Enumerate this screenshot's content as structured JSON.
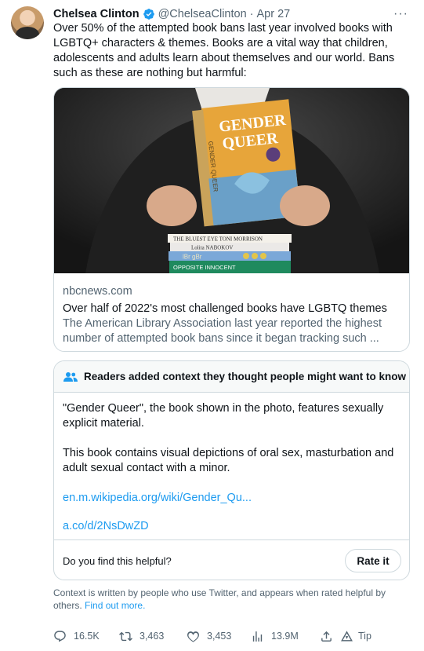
{
  "author": {
    "name": "Chelsea Clinton",
    "handle": "@ChelseaClinton",
    "separator": "·",
    "date": "Apr 27",
    "more_label": "···"
  },
  "tweet": {
    "text": "Over 50% of the attempted book bans last year involved books with LGBTQ+ characters & themes. Books are a vital way that children, adolescents and adults learn about themselves and our world. Bans such as these are nothing but harmful:"
  },
  "card": {
    "book_title_line1": "GENDER",
    "book_title_line2": "QUEER",
    "book_spine": "GENDER QUEER",
    "stack_books": [
      "THE BLUEST EYE   TONI MORRISON",
      "Lolita   NABOKOV",
      "lBr gBr",
      "OPPOSITE  INNOCENT"
    ],
    "domain": "nbcnews.com",
    "title": "Over half of 2022's most challenged books have LGBTQ themes",
    "description": "The American Library Association last year reported the highest number of attempted book bans since it began tracking such ..."
  },
  "note": {
    "heading": "Readers added context they thought people might want to know",
    "paragraph1": "\"Gender Queer\", the book shown in the photo, features sexually explicit material.",
    "paragraph2": "This book contains visual depictions of oral sex, masturbation and adult sexual contact with a minor.",
    "link1": "en.m.wikipedia.org/wiki/Gender_Qu...",
    "link2": "a.co/d/2NsDwZD",
    "helpful_question": "Do you find this helpful?",
    "rate_label": "Rate it"
  },
  "context": {
    "text": "Context is written by people who use Twitter, and appears when rated helpful by others.",
    "link": "Find out more."
  },
  "actions": {
    "replies": "16.5K",
    "retweets": "3,463",
    "likes": "3,453",
    "views": "13.9M",
    "tip_label": "Tip"
  },
  "colors": {
    "accent": "#1d9bf0",
    "secondary_text": "#536471",
    "border": "#cfd9de"
  }
}
